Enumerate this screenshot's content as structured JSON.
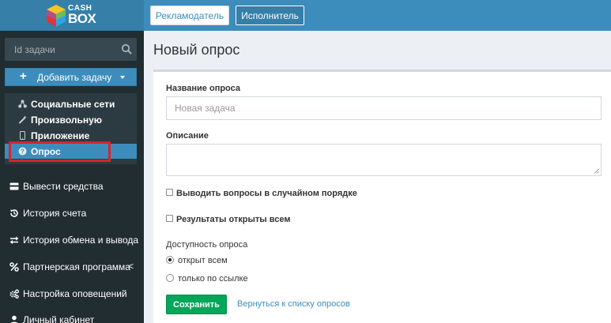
{
  "logo": {
    "line1": "CASH",
    "line2": "BOX"
  },
  "search": {
    "placeholder": "Id задачи"
  },
  "sidebar": {
    "add_task_label": "Добавить задачу",
    "submenu": [
      {
        "label": "Социальные сети",
        "icon": "share-icon"
      },
      {
        "label": "Произвольную",
        "icon": "magic-icon"
      },
      {
        "label": "Приложение",
        "icon": "mobile-icon"
      },
      {
        "label": "Опрос",
        "icon": "question-circle-icon",
        "active": true
      }
    ],
    "nav": [
      {
        "label": "Вывести средства",
        "icon": "card-icon"
      },
      {
        "label": "История счета",
        "icon": "history-icon"
      },
      {
        "label": "История обмена и вывода",
        "icon": "exchange-icon"
      },
      {
        "label": "Партнерская программа",
        "icon": "percent-icon",
        "chevron": "<"
      },
      {
        "label": "Настройка оповещений",
        "icon": "cogs-icon"
      },
      {
        "label": "Личный кабинет",
        "icon": "user-icon"
      }
    ]
  },
  "topbar": {
    "advertiser": "Рекламодатель",
    "executor": "Исполнитель"
  },
  "page": {
    "title": "Новый опрос"
  },
  "form": {
    "name_label": "Название опроса",
    "name_placeholder": "Новая задача",
    "name_value": "",
    "description_label": "Описание",
    "description_value": "",
    "random_order_label": "Выводить вопросы в случайном порядке",
    "random_order_checked": false,
    "results_open_label": "Результаты открыты всем",
    "results_open_checked": false,
    "availability_label": "Доступность опроса",
    "availability_options": [
      {
        "label": "открыт всем",
        "selected": true
      },
      {
        "label": "только по ссылке",
        "selected": false
      }
    ],
    "save_label": "Сохранить",
    "back_label": "Вернуться к списку опросов"
  },
  "colors": {
    "sidebar_bg": "#222d32",
    "brand_blue": "#3c8dbc",
    "success_green": "#00a65a",
    "highlight_red": "#d6232f"
  }
}
